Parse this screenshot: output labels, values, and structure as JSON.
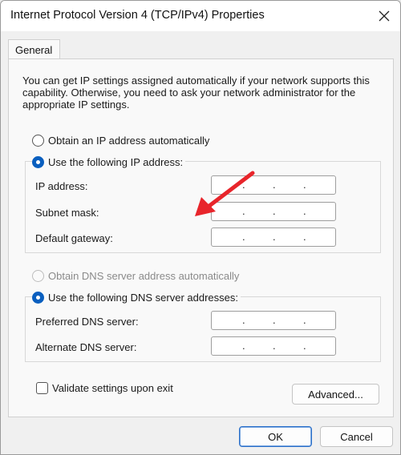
{
  "window": {
    "title": "Internet Protocol Version 4 (TCP/IPv4) Properties"
  },
  "tabs": [
    {
      "label": "General",
      "selected": true
    }
  ],
  "info_text": "You can get IP settings assigned automatically if your network supports this capability. Otherwise, you need to ask your network administrator for the appropriate IP settings.",
  "ip": {
    "auto_option": {
      "label": "Obtain an IP address automatically",
      "checked": false
    },
    "manual_option": {
      "label": "Use the following IP address:",
      "checked": true
    },
    "fields": [
      {
        "label": "IP address:",
        "value": ". . ."
      },
      {
        "label": "Subnet mask:",
        "value": ". . ."
      },
      {
        "label": "Default gateway:",
        "value": ". . ."
      }
    ]
  },
  "dns": {
    "auto_option": {
      "label": "Obtain DNS server address automatically",
      "checked": false,
      "disabled": true
    },
    "manual_option": {
      "label": "Use the following DNS server addresses:",
      "checked": true
    },
    "fields": [
      {
        "label": "Preferred DNS server:",
        "value": ". . ."
      },
      {
        "label": "Alternate DNS server:",
        "value": ". . ."
      }
    ]
  },
  "validate": {
    "label": "Validate settings upon exit",
    "checked": false
  },
  "buttons": {
    "advanced": "Advanced...",
    "ok": "OK",
    "cancel": "Cancel"
  },
  "colors": {
    "accent": "#0a5fbf",
    "arrow": "#e8252b"
  }
}
